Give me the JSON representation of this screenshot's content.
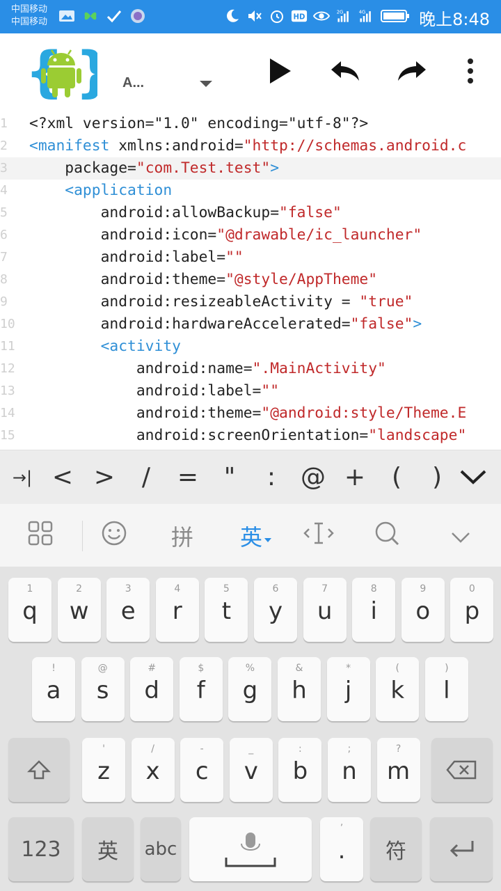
{
  "status_bar": {
    "carrier_1": "中国移动",
    "carrier_2": "中国移动",
    "time": "晚上8:48",
    "signal_labels": [
      "2G",
      "4G"
    ]
  },
  "toolbar": {
    "file_title": "A...",
    "logo_icon": "android-brackets-logo",
    "actions": [
      "play-icon",
      "undo-icon",
      "redo-icon",
      "more-vert-icon"
    ]
  },
  "editor": {
    "line_numbers": [
      "1",
      "2",
      "3",
      "4",
      "5",
      "6",
      "7",
      "8",
      "9",
      "10",
      "11",
      "12",
      "13",
      "14",
      "15"
    ],
    "lines": [
      [
        {
          "t": "<?xml version=\"1.0\" encoding=\"utf-8\"?>",
          "c": "black"
        }
      ],
      [
        {
          "t": "<manifest",
          "c": "blue"
        },
        {
          "t": " xmlns:android=",
          "c": "black"
        },
        {
          "t": "\"http://schemas.android.c",
          "c": "red"
        }
      ],
      [
        {
          "t": "    package=",
          "c": "black"
        },
        {
          "t": "\"com.Test.test\"",
          "c": "red"
        },
        {
          "t": ">",
          "c": "blue"
        }
      ],
      [
        {
          "t": "    <application",
          "c": "blue"
        }
      ],
      [
        {
          "t": "        android:allowBackup=",
          "c": "black"
        },
        {
          "t": "\"false\"",
          "c": "red"
        }
      ],
      [
        {
          "t": "        android:icon=",
          "c": "black"
        },
        {
          "t": "\"@drawable/ic_launcher\"",
          "c": "red"
        }
      ],
      [
        {
          "t": "        android:label=",
          "c": "black"
        },
        {
          "t": "\"\"",
          "c": "red"
        }
      ],
      [
        {
          "t": "        android:theme=",
          "c": "black"
        },
        {
          "t": "\"@style/AppTheme\"",
          "c": "red"
        }
      ],
      [
        {
          "t": "        android:resizeableActivity = ",
          "c": "black"
        },
        {
          "t": "\"true\"",
          "c": "red"
        }
      ],
      [
        {
          "t": "        android:hardwareAccelerated=",
          "c": "black"
        },
        {
          "t": "\"false\"",
          "c": "red"
        },
        {
          "t": ">",
          "c": "blue"
        }
      ],
      [
        {
          "t": "        <activity",
          "c": "blue"
        }
      ],
      [
        {
          "t": "            android:name=",
          "c": "black"
        },
        {
          "t": "\".MainActivity\"",
          "c": "red"
        }
      ],
      [
        {
          "t": "            android:label=",
          "c": "black"
        },
        {
          "t": "\"\"",
          "c": "red"
        }
      ],
      [
        {
          "t": "            android:theme=",
          "c": "black"
        },
        {
          "t": "\"@android:style/Theme.E",
          "c": "red"
        }
      ],
      [
        {
          "t": "            android:screenOrientation=",
          "c": "black"
        },
        {
          "t": "\"landscape\"",
          "c": "red"
        }
      ]
    ],
    "current_line": 3
  },
  "symbol_bar": {
    "tab_symbol": "→|",
    "symbols": [
      "<",
      ">",
      "/",
      "=",
      "\"",
      ":",
      "@",
      "+",
      "(",
      ")"
    ],
    "collapse_icon": "chevron-down-icon"
  },
  "ime_toolbar": {
    "pinyin_label": "拼",
    "english_label": "英",
    "items": [
      "grid-icon",
      "emoji-icon",
      "pinyin",
      "english",
      "cursor-icon",
      "search-icon",
      "hide-keyboard-icon"
    ]
  },
  "keyboard": {
    "row1": [
      {
        "main": "q",
        "hint": "1"
      },
      {
        "main": "w",
        "hint": "2"
      },
      {
        "main": "e",
        "hint": "3"
      },
      {
        "main": "r",
        "hint": "4"
      },
      {
        "main": "t",
        "hint": "5"
      },
      {
        "main": "y",
        "hint": "6"
      },
      {
        "main": "u",
        "hint": "7"
      },
      {
        "main": "i",
        "hint": "8"
      },
      {
        "main": "o",
        "hint": "9"
      },
      {
        "main": "p",
        "hint": "0"
      }
    ],
    "row2": [
      {
        "main": "a",
        "hint": "!"
      },
      {
        "main": "s",
        "hint": "@"
      },
      {
        "main": "d",
        "hint": "#"
      },
      {
        "main": "f",
        "hint": "$"
      },
      {
        "main": "g",
        "hint": "%"
      },
      {
        "main": "h",
        "hint": "&"
      },
      {
        "main": "j",
        "hint": "*"
      },
      {
        "main": "k",
        "hint": "("
      },
      {
        "main": "l",
        "hint": ")"
      }
    ],
    "row3": [
      {
        "main": "z",
        "hint": "'"
      },
      {
        "main": "x",
        "hint": "/"
      },
      {
        "main": "c",
        "hint": "-"
      },
      {
        "main": "v",
        "hint": "_"
      },
      {
        "main": "b",
        "hint": ":"
      },
      {
        "main": "n",
        "hint": ";"
      },
      {
        "main": "m",
        "hint": "?"
      }
    ],
    "row4": {
      "numbers_label": "123",
      "lang_label": "英",
      "abc_label": "abc",
      "dot_hint": "’",
      "dot_label": ".",
      "symbol_label": "符"
    }
  }
}
